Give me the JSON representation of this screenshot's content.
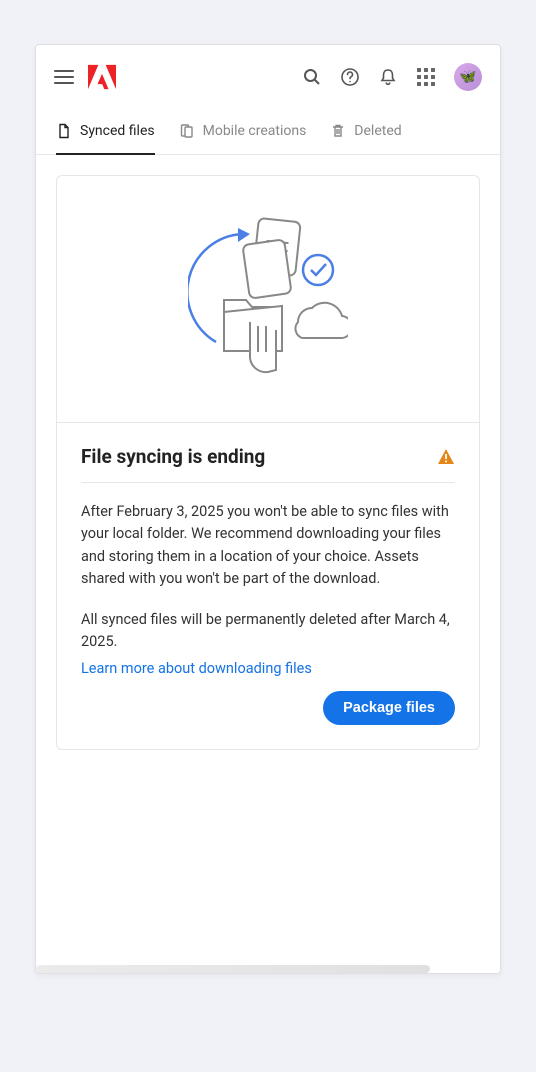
{
  "header": {
    "icons": {
      "menu": "menu",
      "logo": "adobe",
      "search": "search",
      "help": "help",
      "notifications": "bell",
      "apps": "apps-grid",
      "avatar": "avatar"
    }
  },
  "tabs": [
    {
      "id": "synced",
      "label": "Synced files",
      "icon": "file",
      "active": true
    },
    {
      "id": "mobile",
      "label": "Mobile creations",
      "icon": "mobile",
      "active": false
    },
    {
      "id": "deleted",
      "label": "Deleted",
      "icon": "trash",
      "active": false
    }
  ],
  "card": {
    "title": "File syncing is ending",
    "warning_icon": "warning",
    "paragraph1": "After February 3, 2025 you won't be able to sync files with your local folder. We recommend downloading your files and storing them in a location of your choice. Assets shared with you won't be part of the download.",
    "paragraph2": "All synced files will be permanently deleted after March 4, 2025.",
    "link_text": "Learn more about downloading files",
    "button_label": "Package files"
  },
  "colors": {
    "accent": "#1473e6",
    "adobe_red": "#ed2224",
    "warning": "#e68619"
  }
}
